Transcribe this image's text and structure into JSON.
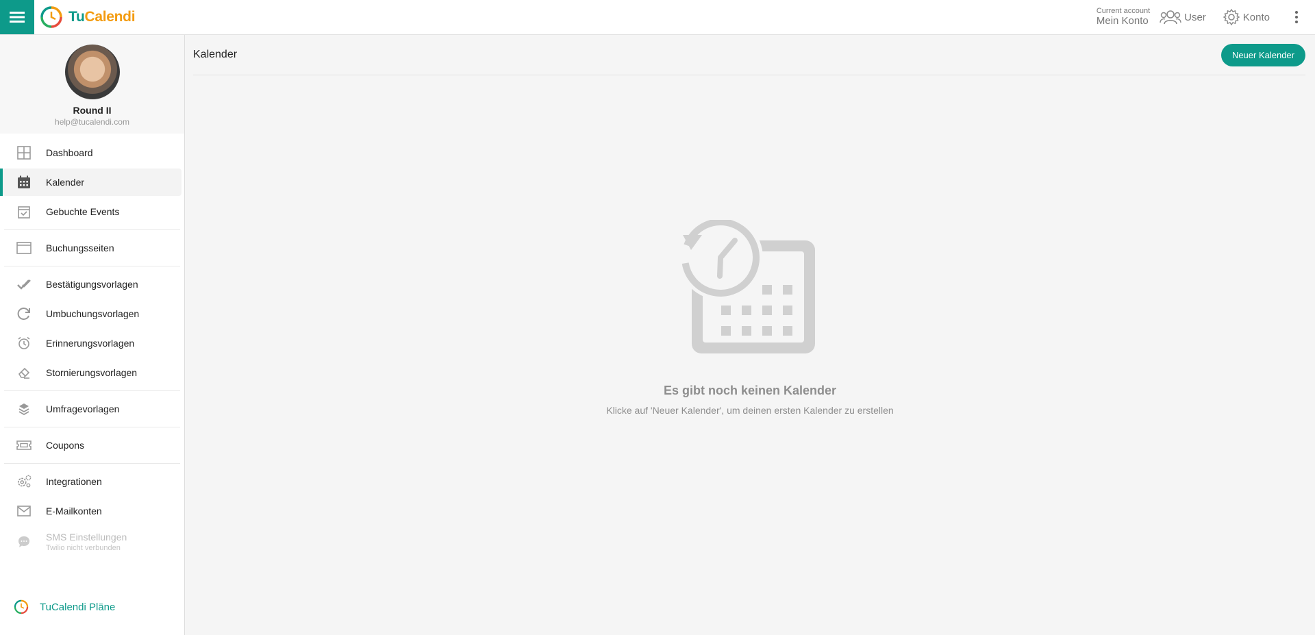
{
  "brand": {
    "name_part1": "Tu",
    "name_part2": "Calendi"
  },
  "topbar": {
    "account_caption": "Current account",
    "account_name": "Mein Konto",
    "user_label": "User",
    "konto_label": "Konto"
  },
  "profile": {
    "name": "Round II",
    "email": "help@tucalendi.com"
  },
  "sidebar": {
    "items": [
      {
        "label": "Dashboard",
        "icon": "grid-icon"
      },
      {
        "label": "Kalender",
        "icon": "calendar-icon",
        "active": true
      },
      {
        "label": "Gebuchte Events",
        "icon": "calendar-check-icon"
      },
      {
        "label": "Buchungsseiten",
        "icon": "browser-window-icon"
      },
      {
        "label": "Bestätigungsvorlagen",
        "icon": "double-check-icon"
      },
      {
        "label": "Umbuchungsvorlagen",
        "icon": "refresh-icon"
      },
      {
        "label": "Erinnerungsvorlagen",
        "icon": "alarm-clock-icon"
      },
      {
        "label": "Stornierungsvorlagen",
        "icon": "eraser-icon"
      },
      {
        "label": "Umfragevorlagen",
        "icon": "layers-icon"
      },
      {
        "label": "Coupons",
        "icon": "ticket-icon"
      },
      {
        "label": "Integrationen",
        "icon": "gears-icon"
      },
      {
        "label": "E-Mailkonten",
        "icon": "envelope-icon"
      },
      {
        "label": "SMS Einstellungen",
        "sublabel": "Twilio nicht verbunden",
        "icon": "chat-bubble-icon",
        "disabled": true
      }
    ],
    "plans_label": "TuCalendi Pläne"
  },
  "main": {
    "title": "Kalender",
    "new_button": "Neuer Kalender",
    "empty_title": "Es gibt noch keinen Kalender",
    "empty_subtitle": "Klicke auf 'Neuer Kalender', um deinen ersten Kalender zu erstellen"
  },
  "colors": {
    "accent": "#0d9a8a",
    "brand_orange": "#f39c12",
    "muted": "#8e8e8e"
  }
}
